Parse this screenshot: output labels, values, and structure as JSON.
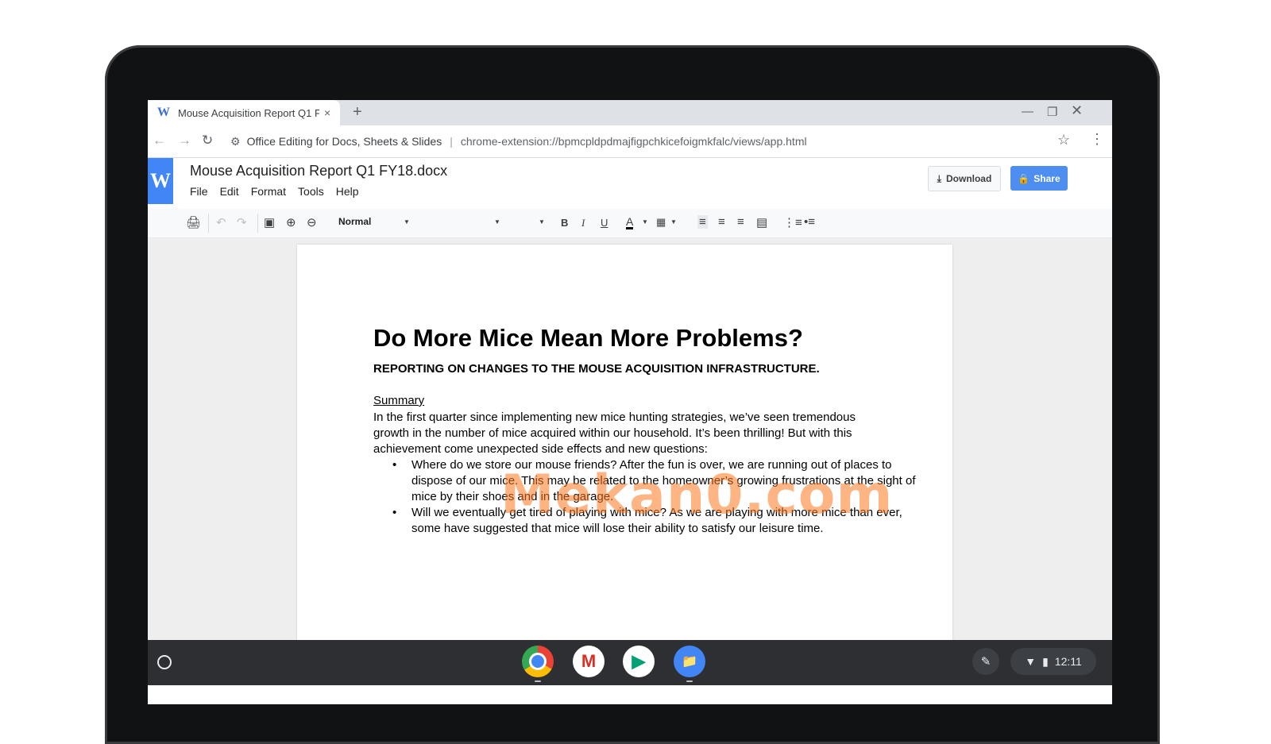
{
  "browser": {
    "tab_title": "Mouse Acquisition Report Q1 F",
    "tab_close": "×",
    "new_tab": "+",
    "extension_name": "Office Editing for Docs, Sheets & Slides",
    "separator": "|",
    "url": "chrome-extension://bpmcpldpdmajfigpchkicefoigmkfalc/views/app.html"
  },
  "app": {
    "logo_letter": "W",
    "document_title": "Mouse Acquisition Report Q1 FY18.docx",
    "menu": [
      "File",
      "Edit",
      "Format",
      "Tools",
      "Help"
    ],
    "download_label": "Download",
    "share_label": "Share",
    "style_value": "Normal"
  },
  "document": {
    "title": "Do More Mice Mean More Problems?",
    "subtitle": "REPORTING ON CHANGES TO THE MOUSE ACQUISITION INFRASTRUCTURE.",
    "summary_label": "Summary",
    "summary_text": "In the first quarter since implementing new mice hunting strategies, we’ve seen tremendous growth in the number of mice acquired within our household. It’s been thrilling! But with this achievement come unexpected side effects and new questions:",
    "bullets": [
      "Where do we store our mouse friends? After the fun is over, we are running out of places to dispose of our mice. This may be related to the homeowner’s growing frustrations at the sight of mice by their shoes and in the garage.",
      "Will we eventually get tired of playing with mice? As we are playing with more mice than ever, some have suggested that mice will lose their ability to satisfy our leisure time."
    ],
    "watermark": "Mekan0.com"
  },
  "shelf": {
    "apps": [
      "chrome",
      "gmail",
      "play-store",
      "files"
    ],
    "time": "12:11"
  },
  "colors": {
    "brand_blue": "#4285f4",
    "share_blue": "#4d8ef0",
    "shelf_bg": "#2d2f33",
    "watermark_orange": "#ff781e"
  }
}
